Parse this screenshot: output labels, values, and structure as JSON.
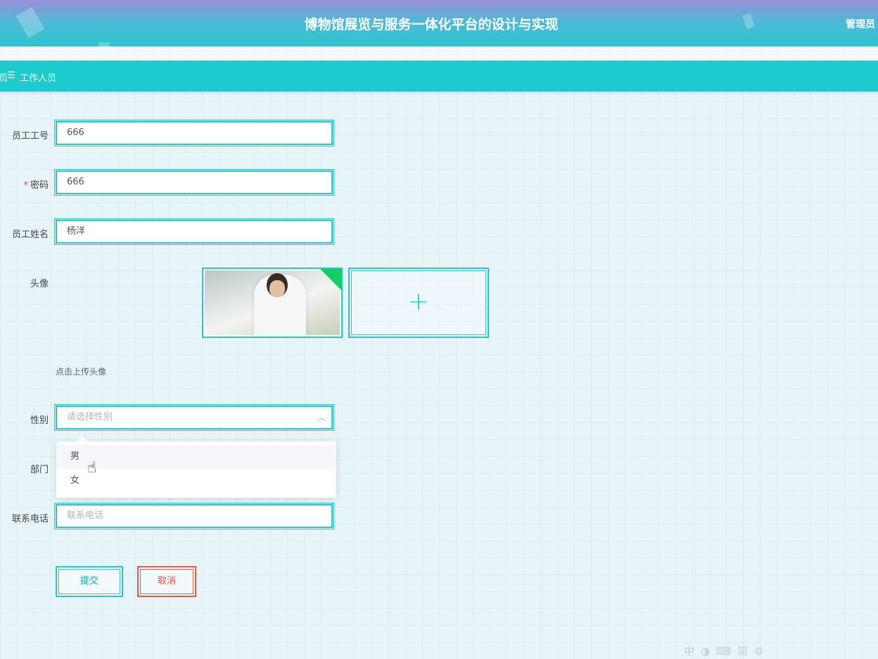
{
  "header": {
    "title": "博物馆展览与服务一体化平台的设计与实现",
    "user_label": "管理员"
  },
  "breadcrumb": {
    "home_tail": "页",
    "separator_icon": "☰",
    "current": "工作人员"
  },
  "form": {
    "employee_no": {
      "label": "员工工号",
      "value": "666"
    },
    "password": {
      "required_mark": "*",
      "label": "密码",
      "value": "666"
    },
    "employee_name": {
      "label": "员工姓名",
      "value": "杨洋"
    },
    "avatar": {
      "label": "头像",
      "tip": "点击上传头像"
    },
    "gender": {
      "label": "性别",
      "placeholder": "请选择性别",
      "options": [
        "男",
        "女"
      ]
    },
    "department": {
      "label": "部门"
    },
    "phone": {
      "label": "联系电话",
      "placeholder": "联系电话"
    },
    "submit_label": "提交",
    "cancel_label": "取消"
  },
  "ime_toolbar": "中 ◑ ⌨ 简 ⚙",
  "colors": {
    "accent": "#2bc5c8",
    "header_bar": "#1ccbce",
    "danger": "#e4554a",
    "success": "#13ce66"
  }
}
